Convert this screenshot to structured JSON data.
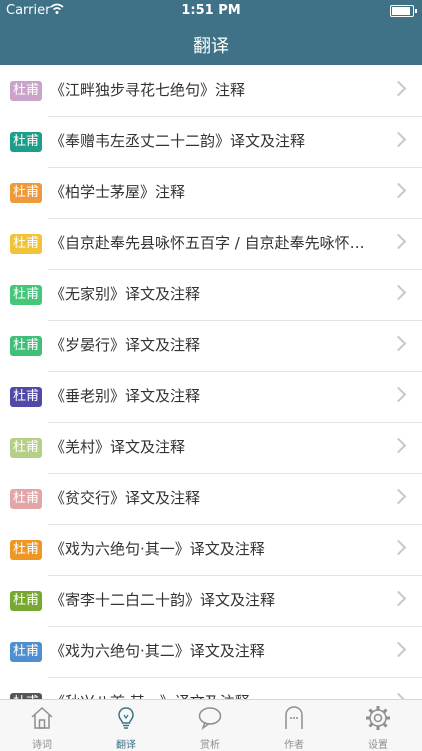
{
  "status": {
    "carrier": "Carrier",
    "time": "1:51 PM"
  },
  "nav": {
    "title": "翻译"
  },
  "colors": {
    "bar": "#3f7187",
    "active_tab": "#3f7187",
    "inactive_tab": "#8e8e93"
  },
  "rows": [
    {
      "badge": "杜甫",
      "badge_color": "#c9a3c9",
      "label": "《江畔独步寻花七绝句》注释"
    },
    {
      "badge": "杜甫",
      "badge_color": "#1e9e8a",
      "label": "《奉赠韦左丞丈二十二韵》译文及注释"
    },
    {
      "badge": "杜甫",
      "badge_color": "#ee9a3a",
      "label": "《柏学士茅屋》注释"
    },
    {
      "badge": "杜甫",
      "badge_color": "#f1c437",
      "label": "《自京赴奉先县咏怀五百字 / 自京赴奉先咏怀五百字》译文及注释"
    },
    {
      "badge": "杜甫",
      "badge_color": "#45c77a",
      "label": "《无家别》译文及注释"
    },
    {
      "badge": "杜甫",
      "badge_color": "#3fbf77",
      "label": "《岁晏行》译文及注释"
    },
    {
      "badge": "杜甫",
      "badge_color": "#5149a8",
      "label": "《垂老别》译文及注释"
    },
    {
      "badge": "杜甫",
      "badge_color": "#b6cf86",
      "label": "《羌村》译文及注释"
    },
    {
      "badge": "杜甫",
      "badge_color": "#e3a6a6",
      "label": "《贫交行》译文及注释"
    },
    {
      "badge": "杜甫",
      "badge_color": "#ee9723",
      "label": "《戏为六绝句·其一》译文及注释"
    },
    {
      "badge": "杜甫",
      "badge_color": "#78a832",
      "label": "《寄李十二白二十韵》译文及注释"
    },
    {
      "badge": "杜甫",
      "badge_color": "#4f8fcf",
      "label": "《戏为六绝句·其二》译文及注释"
    },
    {
      "badge": "杜甫",
      "badge_color": "#555555",
      "label": "《秋兴八首·其一》译文及注释"
    }
  ],
  "tabs": [
    {
      "label": "诗词",
      "icon": "home-icon"
    },
    {
      "label": "翻译",
      "icon": "lightbulb-icon"
    },
    {
      "label": "赏析",
      "icon": "chat-bubble-icon"
    },
    {
      "label": "作者",
      "icon": "person-icon"
    },
    {
      "label": "设置",
      "icon": "gear-icon"
    }
  ]
}
